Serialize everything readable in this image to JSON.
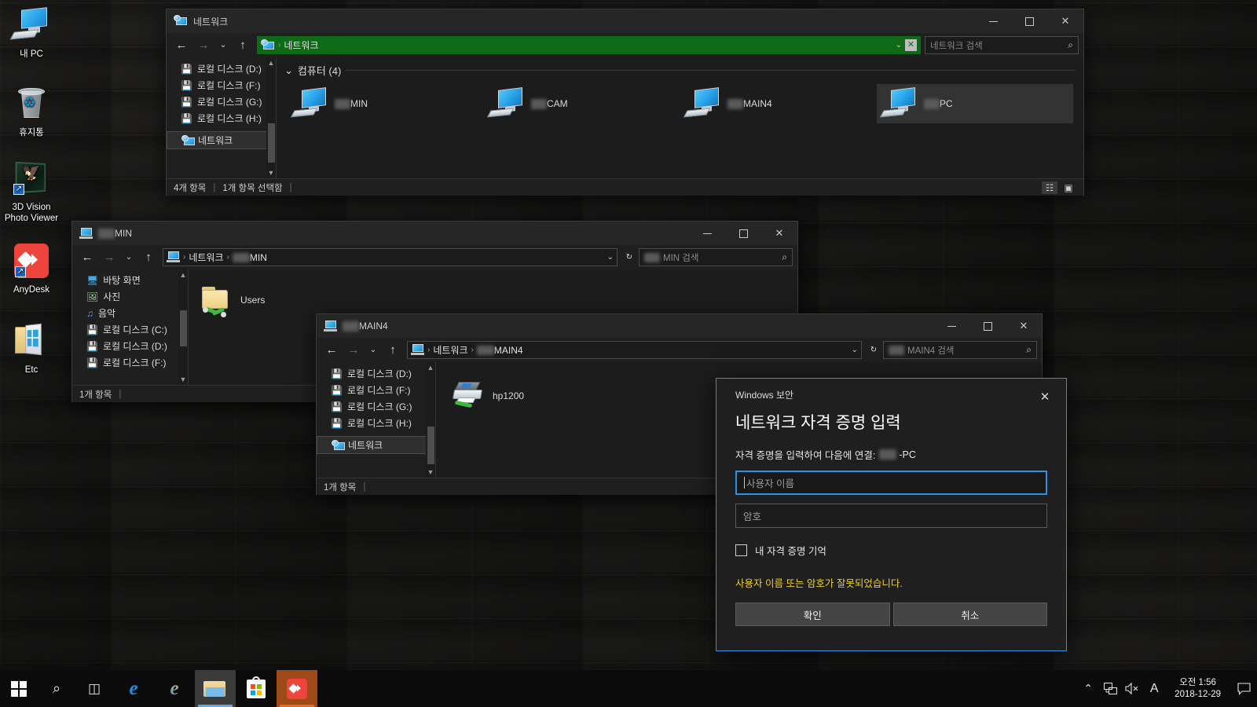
{
  "desktop": {
    "icons": [
      {
        "label": "내 PC",
        "icon": "my-computer-icon"
      },
      {
        "label": "휴지통",
        "icon": "recycle-bin-icon"
      },
      {
        "label": "3D Vision\nPhoto Viewer",
        "label_line1": "3D Vision",
        "label_line2": "Photo Viewer",
        "icon": "3d-vision-photo-viewer-icon"
      },
      {
        "label": "AnyDesk",
        "icon": "anydesk-icon"
      },
      {
        "label": "Etc",
        "icon": "etc-folder-icon"
      }
    ]
  },
  "network_window": {
    "title": "네트워크",
    "title_icon": "network-icon",
    "minimize": "—",
    "maximize": "□",
    "close": "✕",
    "nav": {
      "back": "←",
      "forward": "→",
      "recent": "⌄",
      "up": "↑"
    },
    "address": {
      "root_icon": "network-icon",
      "sep": "›",
      "crumb": "네트워크",
      "chevron": "⌄",
      "stop": "✕"
    },
    "search_placeholder": "네트워크 검색",
    "search_icon": "search-icon",
    "tree": [
      {
        "label": "로컬 디스크 (D:)",
        "icon": "drive-icon",
        "selected": false
      },
      {
        "label": "로컬 디스크 (F:)",
        "icon": "drive-icon",
        "selected": false
      },
      {
        "label": "로컬 디스크 (G:)",
        "icon": "drive-icon",
        "selected": false
      },
      {
        "label": "로컬 디스크 (H:)",
        "icon": "drive-icon",
        "selected": false
      },
      {
        "label": "네트워크",
        "icon": "network-icon",
        "selected": true
      }
    ],
    "group_header": "컴퓨터 (4)",
    "group_chevron": "⌄",
    "computers": [
      {
        "name": "MIN",
        "redacted_prefix": true,
        "selected": false
      },
      {
        "name": "CAM",
        "redacted_prefix": true,
        "selected": false
      },
      {
        "name": "MAIN4",
        "redacted_prefix": true,
        "selected": false
      },
      {
        "name": "PC",
        "redacted_prefix": true,
        "selected": true
      }
    ],
    "status_items": [
      "4개 항목",
      "1개 항목 선택함"
    ],
    "view_buttons": [
      "details-view-icon",
      "large-icons-view-icon"
    ]
  },
  "min_window": {
    "title": "MIN",
    "title_redacted_prefix": true,
    "title_icon": "computer-icon",
    "minimize": "—",
    "maximize": "□",
    "close": "✕",
    "nav": {
      "back": "←",
      "forward": "→",
      "recent": "⌄",
      "up": "↑"
    },
    "address": {
      "root_icon": "computer-icon",
      "sep": "›",
      "crumb1": "네트워크",
      "crumb2": "MIN",
      "chevron": "⌄",
      "refresh": "↻"
    },
    "search_placeholder": "MIN 검색",
    "search_icon": "search-icon",
    "tree": [
      {
        "label": "바탕 화면",
        "icon": "desktop-icon"
      },
      {
        "label": "사진",
        "icon": "pictures-icon"
      },
      {
        "label": "음악",
        "icon": "music-icon"
      },
      {
        "label": "로컬 디스크 (C:)",
        "icon": "system-drive-icon"
      },
      {
        "label": "로컬 디스크 (D:)",
        "icon": "drive-icon"
      },
      {
        "label": "로컬 디스크 (F:)",
        "icon": "drive-icon"
      }
    ],
    "items": [
      {
        "name": "Users",
        "icon": "shared-folder-icon"
      }
    ],
    "status_items": [
      "1개 항목"
    ]
  },
  "main4_window": {
    "title": "MAIN4",
    "title_redacted_prefix": true,
    "title_icon": "computer-icon",
    "minimize": "—",
    "maximize": "□",
    "close": "✕",
    "nav": {
      "back": "←",
      "forward": "→",
      "recent": "⌄",
      "up": "↑"
    },
    "address": {
      "root_icon": "computer-icon",
      "sep": "›",
      "crumb1": "네트워크",
      "crumb2": "MAIN4",
      "chevron": "⌄",
      "refresh": "↻"
    },
    "search_placeholder": "MAIN4 검색",
    "search_icon": "search-icon",
    "tree": [
      {
        "label": "로컬 디스크 (D:)",
        "icon": "drive-icon",
        "selected": false
      },
      {
        "label": "로컬 디스크 (F:)",
        "icon": "drive-icon",
        "selected": false
      },
      {
        "label": "로컬 디스크 (G:)",
        "icon": "drive-icon",
        "selected": false
      },
      {
        "label": "로컬 디스크 (H:)",
        "icon": "drive-icon",
        "selected": false
      },
      {
        "label": "네트워크",
        "icon": "network-icon",
        "selected": true
      }
    ],
    "items": [
      {
        "name": "hp1200",
        "icon": "printer-icon"
      }
    ],
    "status_items": [
      "1개 항목"
    ]
  },
  "security_dialog": {
    "app_name": "Windows 보안",
    "close": "✕",
    "title": "네트워크 자격 증명 입력",
    "subtitle_prefix": "자격 증명을 입력하여 다음에 연결:",
    "subtitle_target": "-PC",
    "subtitle_redacted_prefix": true,
    "username_placeholder": "사용자 이름",
    "username_value": "",
    "password_placeholder": "암호",
    "password_value": "",
    "remember_label": "내 자격 증명 기억",
    "remember_checked": false,
    "error_message": "사용자 이름 또는 암호가 잘못되었습니다.",
    "error_color": "#f2d11f",
    "ok_label": "확인",
    "cancel_label": "취소",
    "accent_color": "#2f8fe0"
  },
  "taskbar": {
    "start_icon": "windows-start-icon",
    "search_icon": "search-icon",
    "taskview_icon": "task-view-icon",
    "apps": [
      {
        "name": "Microsoft Edge",
        "icon": "edge-icon",
        "state": "pinned"
      },
      {
        "name": "Internet Explorer",
        "icon": "internet-explorer-icon",
        "state": "pinned"
      },
      {
        "name": "파일 탐색기",
        "icon": "file-explorer-icon",
        "state": "active"
      },
      {
        "name": "Microsoft Store",
        "icon": "store-icon",
        "state": "pinned"
      },
      {
        "name": "AnyDesk",
        "icon": "anydesk-icon",
        "state": "running"
      }
    ],
    "tray": [
      {
        "icon": "show-hidden-icons-chevron",
        "glyph": "⌃"
      },
      {
        "icon": "network-icon",
        "glyph": ""
      },
      {
        "icon": "volume-muted-icon",
        "glyph": ""
      },
      {
        "icon": "ime-korean-icon",
        "glyph": "A"
      }
    ],
    "clock_time": "오전 1:56",
    "clock_date": "2018-12-29",
    "action_center_icon": "action-center-icon"
  }
}
